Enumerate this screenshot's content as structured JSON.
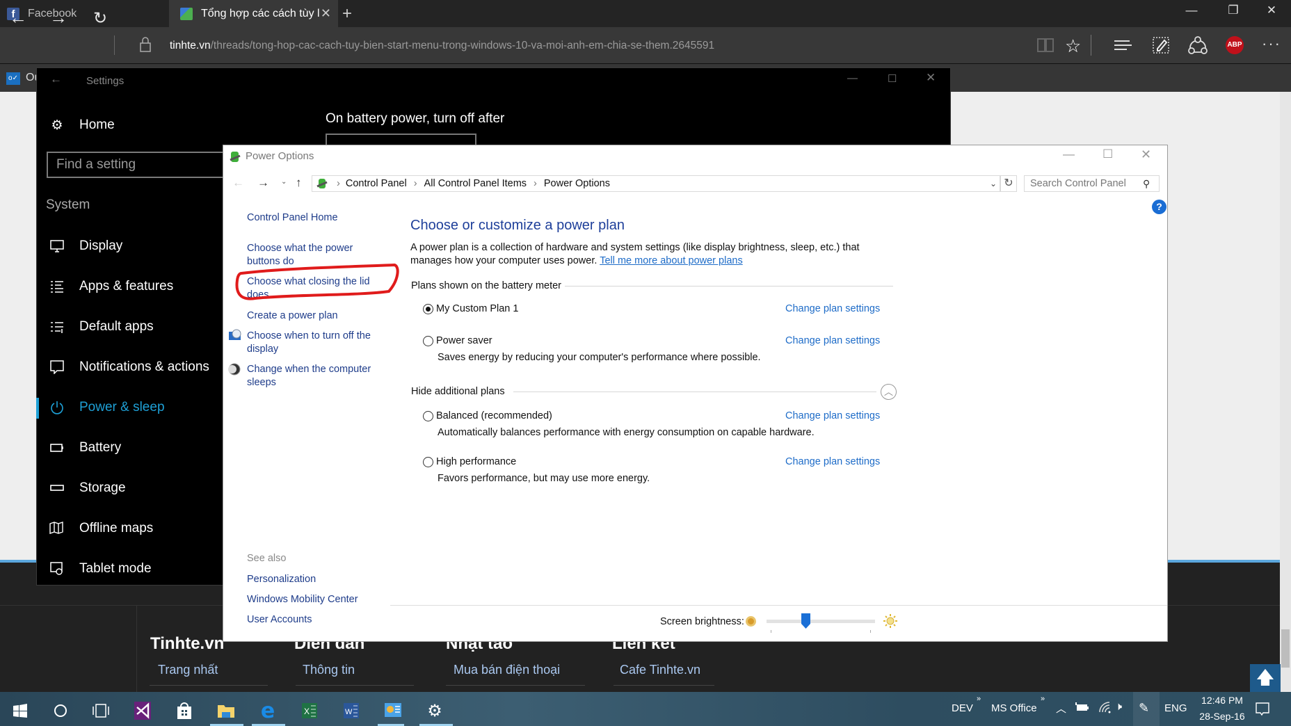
{
  "browser": {
    "tabs": [
      {
        "label": "Facebook",
        "icon": "facebook-icon",
        "active": false
      },
      {
        "label": "Tổng hợp các cách tùy l",
        "icon": "tinhte-icon",
        "active": true
      }
    ],
    "url_domain": "tinhte.vn",
    "url_path": "/threads/tong-hop-cac-cach-tuy-bien-start-menu-trong-windows-10-va-moi-anh-em-chia-se-them.2645591",
    "favorites_partial": "Ou",
    "toolbar_icons": [
      "reading-view-icon",
      "favorite-star-icon",
      "hub-icon",
      "web-note-icon",
      "share-icon",
      "adblock-plus-icon",
      "more-icon"
    ],
    "abp_label": "ABP",
    "more_label": "···"
  },
  "page": {
    "footer_columns": [
      {
        "heading": "Tinhte.vn",
        "link": "Trang nhất"
      },
      {
        "heading": "Diễn đàn",
        "link": "Thông tin"
      },
      {
        "heading": "Nhật tảo",
        "link": "Mua bán điện thoại"
      },
      {
        "heading": "Liên kết",
        "link": "Cafe Tinhte.vn"
      }
    ]
  },
  "settings": {
    "title": "Settings",
    "home": "Home",
    "search_placeholder": "Find a setting",
    "section": "System",
    "nav": [
      {
        "label": "Display",
        "icon": "display-icon"
      },
      {
        "label": "Apps & features",
        "icon": "apps-features-icon"
      },
      {
        "label": "Default apps",
        "icon": "default-apps-icon"
      },
      {
        "label": "Notifications & actions",
        "icon": "notifications-icon"
      },
      {
        "label": "Power & sleep",
        "icon": "power-icon",
        "active": true
      },
      {
        "label": "Battery",
        "icon": "battery-icon"
      },
      {
        "label": "Storage",
        "icon": "storage-icon"
      },
      {
        "label": "Offline maps",
        "icon": "offline-maps-icon"
      },
      {
        "label": "Tablet mode",
        "icon": "tablet-mode-icon"
      }
    ],
    "battery_heading": "On battery power, turn off after",
    "accent": "#1ea0d6"
  },
  "power_options": {
    "title": "Power Options",
    "breadcrumb": [
      "Control Panel",
      "All Control Panel Items",
      "Power Options"
    ],
    "search_placeholder": "Search Control Panel",
    "sidebar": {
      "home": "Control Panel Home",
      "links": [
        {
          "label": "Choose what the power buttons do"
        },
        {
          "label": "Choose what closing the lid does",
          "highlighted": true
        },
        {
          "label": "Create a power plan"
        },
        {
          "label": "Choose when to turn off the display",
          "icon": "display-off-icon"
        },
        {
          "label": "Change when the computer sleeps",
          "icon": "sleep-icon"
        }
      ],
      "see_also": "See also",
      "see_also_links": [
        "Personalization",
        "Windows Mobility Center",
        "User Accounts"
      ]
    },
    "heading": "Choose or customize a power plan",
    "description": "A power plan is a collection of hardware and system settings (like display brightness, sleep, etc.) that manages how your computer uses power.",
    "learn_more": "Tell me more about power plans",
    "group1": "Plans shown on the battery meter",
    "group2": "Hide additional plans",
    "change_label": "Change plan settings",
    "plans": [
      {
        "name": "My Custom Plan 1",
        "selected": true,
        "desc": ""
      },
      {
        "name": "Power saver",
        "selected": false,
        "desc": "Saves energy by reducing your computer's performance where possible."
      },
      {
        "name": "Balanced (recommended)",
        "selected": false,
        "desc": "Automatically balances performance with energy consumption on capable hardware."
      },
      {
        "name": "High performance",
        "selected": false,
        "desc": "Favors performance, but may use more energy."
      }
    ],
    "brightness_label": "Screen brightness:",
    "brightness_value_pct": 36,
    "annotation_color": "#e01b1b"
  },
  "taskbar": {
    "apps": [
      "start-icon",
      "cortana-icon",
      "task-view-icon",
      "visual-studio-icon",
      "store-icon",
      "file-explorer-icon",
      "edge-icon",
      "excel-icon",
      "word-icon",
      "control-panel-icon",
      "settings-icon"
    ],
    "toolbars": [
      "DEV",
      "MS Office"
    ],
    "language": "ENG",
    "time": "12:46 PM",
    "date": "28-Sep-16"
  }
}
